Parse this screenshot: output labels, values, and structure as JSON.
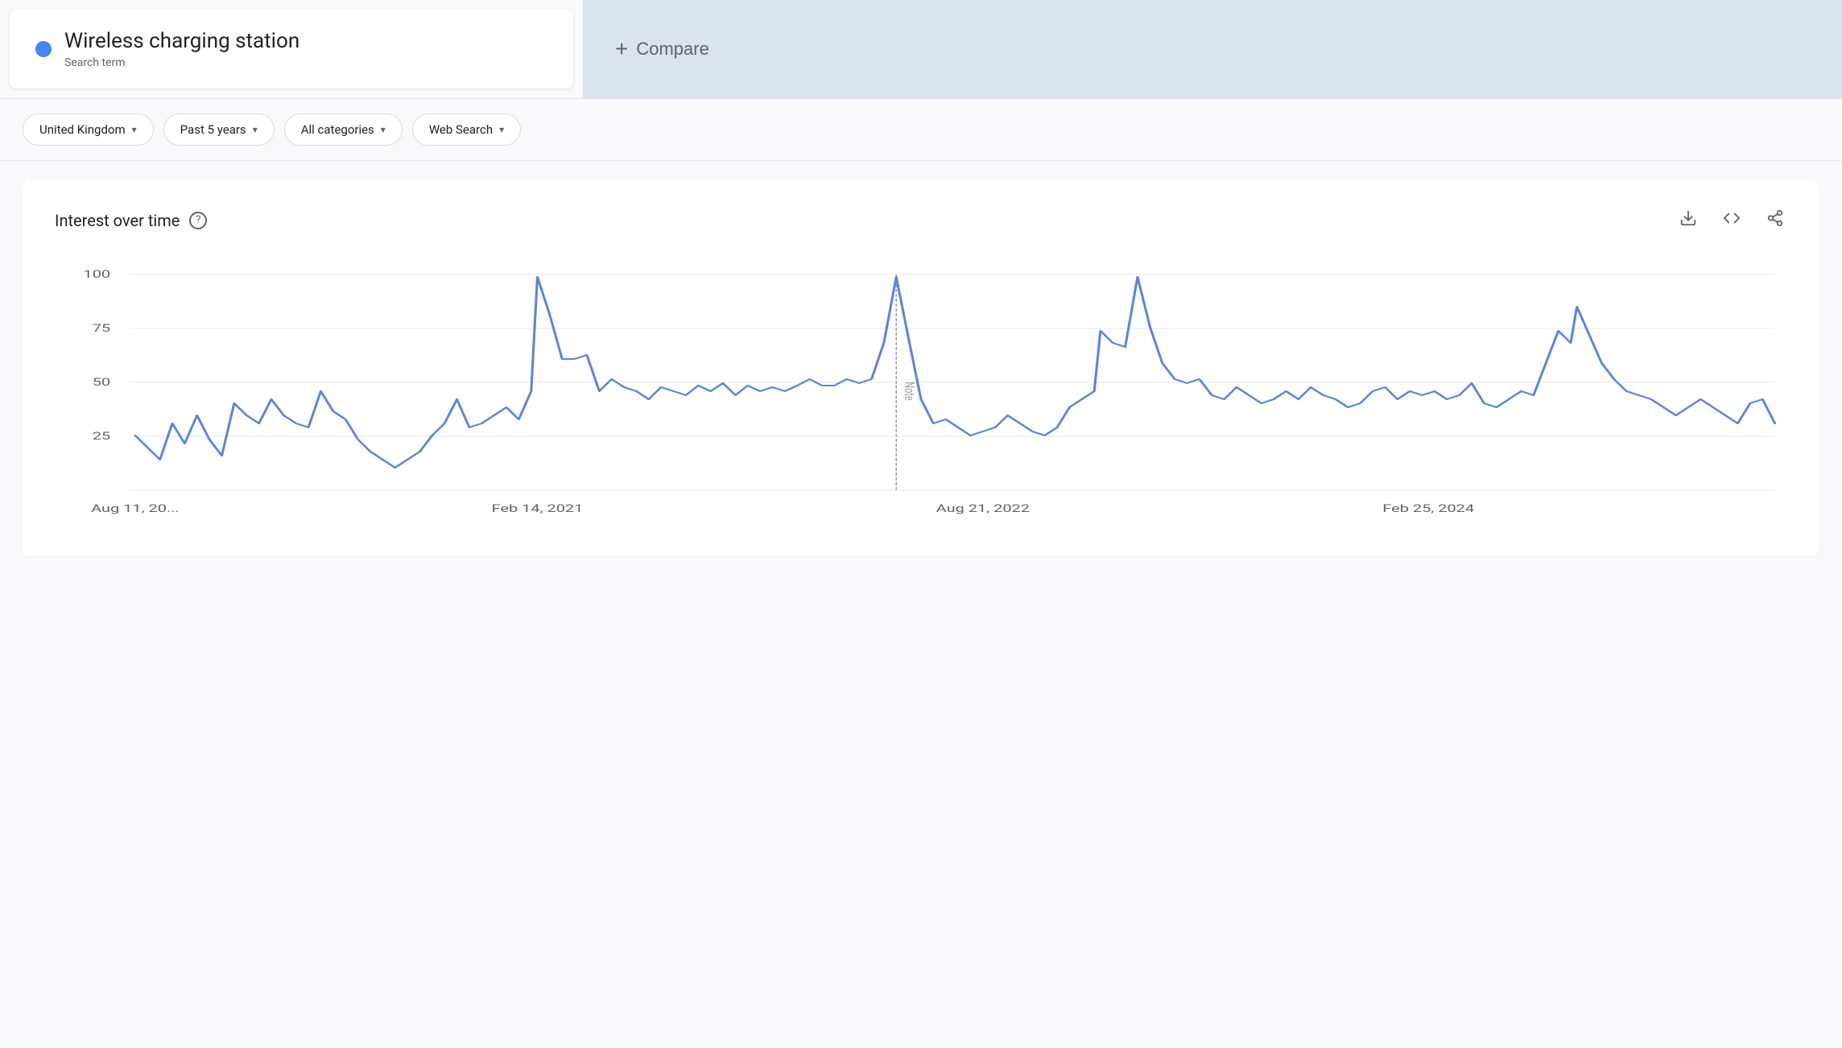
{
  "header": {
    "search_term": {
      "dot_color": "#4285f4",
      "title": "Wireless charging station",
      "subtitle": "Search term"
    },
    "compare": {
      "plus": "+",
      "label": "Compare"
    }
  },
  "filters": [
    {
      "id": "region",
      "label": "United Kingdom",
      "has_chevron": true
    },
    {
      "id": "time",
      "label": "Past 5 years",
      "has_chevron": true
    },
    {
      "id": "category",
      "label": "All categories",
      "has_chevron": true
    },
    {
      "id": "search_type",
      "label": "Web Search",
      "has_chevron": true
    }
  ],
  "chart": {
    "title": "Interest over time",
    "help_icon": "?",
    "y_labels": [
      "100",
      "75",
      "50",
      "25"
    ],
    "x_labels": [
      "Aug 11, 20...",
      "Feb 14, 2021",
      "Aug 21, 2022",
      "Feb 25, 2024"
    ],
    "note_label": "Note",
    "actions": [
      {
        "id": "download",
        "icon": "⬇"
      },
      {
        "id": "embed",
        "icon": "<>"
      },
      {
        "id": "share",
        "icon": "⤴"
      }
    ]
  }
}
